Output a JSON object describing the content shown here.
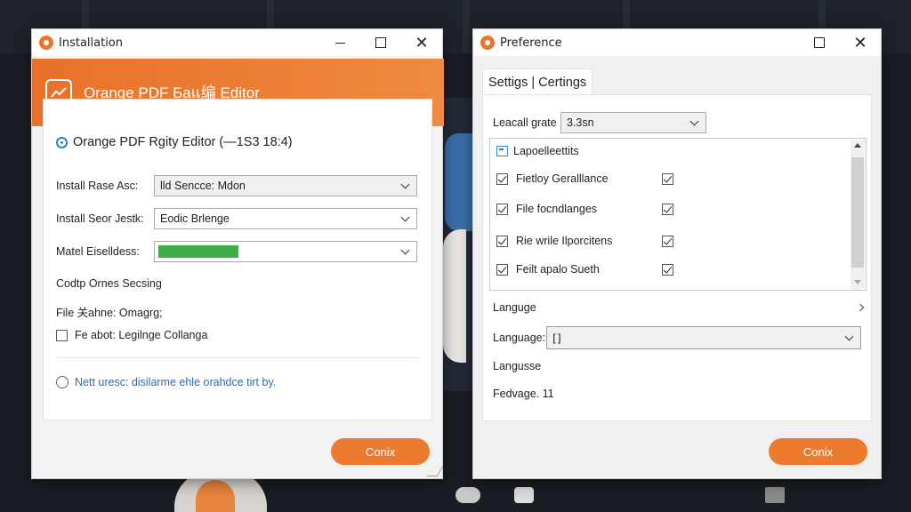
{
  "colors": {
    "accent_orange": "#ec7b2d",
    "progress_green": "#3fae49",
    "link_blue": "#2a6cb5"
  },
  "install_window": {
    "title": "Installation",
    "banner_title": "Orange PDF Бaแ编 Editor",
    "product_line": "Orange PDF Rgity Editor (—1S3 18:4)",
    "fields": [
      {
        "label": "Install Rase Asc:",
        "value": "lld Sencce: Mdon"
      },
      {
        "label": "Install Seor Jestk:",
        "value": "Eodic Brlenge"
      },
      {
        "label": "Matel Eiselldess:",
        "progress": 0.32
      }
    ],
    "line1": "Codtp Ornes Secsing",
    "line2": "File 关ahne: Omagrg;",
    "checkbox_label": "Fe abot: Legilnge Collanga",
    "checkbox_checked": false,
    "radio_label": "Nett uresc: disilarme ehle orahdce tirt by.",
    "button_label": "Conix"
  },
  "pref_window": {
    "title": "Preference",
    "tab_label": "Settigs | Certings",
    "leacall_label": "Leacall grate",
    "leacall_value": "3.3sn",
    "list_header": "Lapoelleettits",
    "list_items": [
      {
        "label": "Fietloy Geralllance",
        "checked_left": true,
        "checked_right": true
      },
      {
        "label": "File focndlanges",
        "checked_left": true,
        "checked_right": true
      },
      {
        "label": "Rie wrile Ilporcitens",
        "checked_left": true,
        "checked_right": true
      },
      {
        "label": "Feilt apalo Sueth",
        "checked_left": true,
        "checked_right": true
      }
    ],
    "language_row": "Languge",
    "language_select_label": "Language:",
    "language_select_value": "[]",
    "line_language": "Langusse",
    "line_feduge": "Fedvage. 11",
    "button_label": "Conix"
  }
}
